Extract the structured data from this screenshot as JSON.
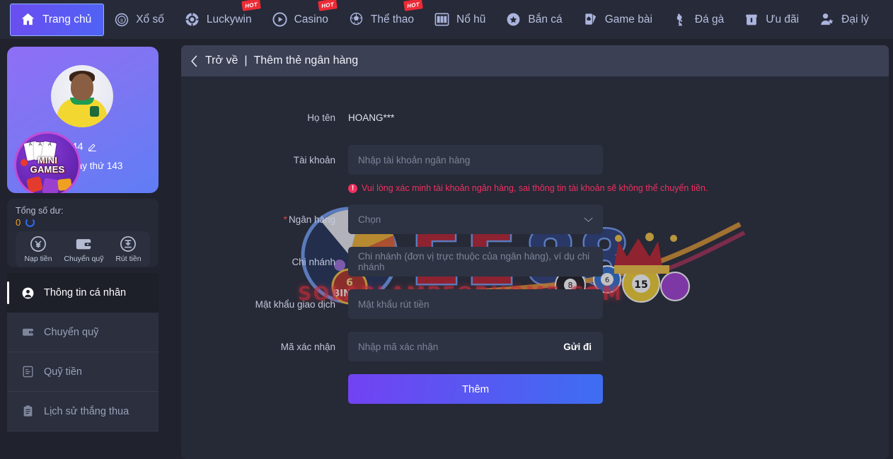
{
  "nav": {
    "items": [
      {
        "label": "Trang chủ",
        "icon": "home-icon",
        "active": true,
        "hot": false
      },
      {
        "label": "Xổ số",
        "icon": "lottery-ball-icon",
        "active": false,
        "hot": false
      },
      {
        "label": "Luckywin",
        "icon": "poker-chip-icon",
        "active": false,
        "hot": true
      },
      {
        "label": "Casino",
        "icon": "play-circle-icon",
        "active": false,
        "hot": true
      },
      {
        "label": "Thể thao",
        "icon": "soccer-ball-icon",
        "active": false,
        "hot": true
      },
      {
        "label": "Nổ hũ",
        "icon": "slot-machine-icon",
        "active": false,
        "hot": false
      },
      {
        "label": "Bắn cá",
        "icon": "fish-target-icon",
        "active": false,
        "hot": false
      },
      {
        "label": "Game bài",
        "icon": "playing-cards-icon",
        "active": false,
        "hot": false
      },
      {
        "label": "Đá gà",
        "icon": "rooster-icon",
        "active": false,
        "hot": false
      },
      {
        "label": "Ưu đãi",
        "icon": "gift-box-icon",
        "active": false,
        "hot": false
      },
      {
        "label": "Đại lý",
        "icon": "agent-user-icon",
        "active": false,
        "hot": false
      }
    ],
    "hot_badge_label": "HOT"
  },
  "sidebar": {
    "profile": {
      "username": "lam2244",
      "login_days": "nhập ngày thứ 143",
      "minigames_line1": "MINI",
      "minigames_line2": "GAMES",
      "card_ranks": [
        "A",
        "A",
        "A"
      ]
    },
    "balance": {
      "label": "Tổng số dư:",
      "amount": "0",
      "actions": [
        {
          "label": "Nạp tiền",
          "icon": "deposit-coin-icon"
        },
        {
          "label": "Chuyển quỹ",
          "icon": "wallet-icon"
        },
        {
          "label": "Rút tiền",
          "icon": "withdraw-atm-icon"
        }
      ]
    },
    "menu": [
      {
        "label": "Thông tin cá nhân",
        "icon": "user-circle-icon",
        "active": true
      },
      {
        "label": "Chuyển quỹ",
        "icon": "wallet-icon",
        "active": false
      },
      {
        "label": "Quỹ tiền",
        "icon": "fund-note-icon",
        "active": false
      },
      {
        "label": "Lịch sử thắng thua",
        "icon": "clipboard-icon",
        "active": false
      }
    ]
  },
  "main": {
    "header": {
      "back_label": "Trở về",
      "separator": "|",
      "title": "Thêm thẻ ngân hàng"
    },
    "form": {
      "fullname": {
        "label": "Họ tên",
        "value": "HOANG***"
      },
      "account": {
        "label": "Tài khoản",
        "placeholder": "Nhập tài khoản ngân hàng",
        "value": ""
      },
      "warning": {
        "icon": "error-circle-icon",
        "text": "Vui lòng xác minh tài khoản ngân hàng, sai thông tin tài khoản sẽ không thể chuyển tiền."
      },
      "bank": {
        "label": "Ngân hàng",
        "required": true,
        "placeholder": "Chọn",
        "value": "",
        "chevron": "chevron-down-icon"
      },
      "branch": {
        "label": "Chi nhánh",
        "placeholder": "Chi nhánh (đơn vị trực thuộc của ngân hàng), ví dụ chi nhánh",
        "value": ""
      },
      "password": {
        "label": "Mật khẩu giao dịch",
        "placeholder": "Mật khẩu rút tiền",
        "value": ""
      },
      "captcha": {
        "label": "Mã xác nhận",
        "placeholder": "Nhập mã xác nhận",
        "value": "",
        "send_label": "Gửi đi"
      },
      "submit_label": "Thêm"
    }
  },
  "watermark": {
    "brand": "EE88",
    "site": "SOLARLAMPFORHOME.COM",
    "bingo_label": "BINGO",
    "bingo_number": "6",
    "ball_numbers": [
      "8",
      "6",
      "15"
    ]
  },
  "colors": {
    "accent_purple": "#7242f2",
    "accent_blue": "#3d6ef2",
    "warning_red": "#f03060",
    "balance_orange": "#f0a42a",
    "nav_bg": "#272a38",
    "panel_bg": "#262936",
    "input_bg": "#2d3342",
    "header_bg": "#3c4055"
  }
}
